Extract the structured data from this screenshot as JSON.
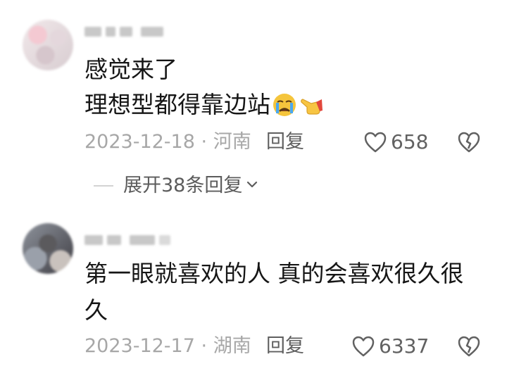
{
  "comments": [
    {
      "username": "",
      "lines": [
        "感觉来了",
        "理想型都得靠边站"
      ],
      "date": "2023-12-18",
      "separator": "·",
      "location": "河南",
      "reply_label": "回复",
      "likes": "658",
      "expand_label": "展开38条回复"
    },
    {
      "username": "",
      "lines": [
        "第一眼就喜欢的人 真的会喜欢很久很",
        "久"
      ],
      "date": "2023-12-17",
      "separator": "·",
      "location": "湖南",
      "reply_label": "回复",
      "likes": "6337"
    }
  ],
  "icons": {
    "emoji_1": "crying-face-emoji",
    "emoji_2": "pointing-hand-emoji",
    "like": "heart-outline-icon",
    "dislike": "broken-heart-outline-icon",
    "expand": "chevron-down-icon"
  }
}
